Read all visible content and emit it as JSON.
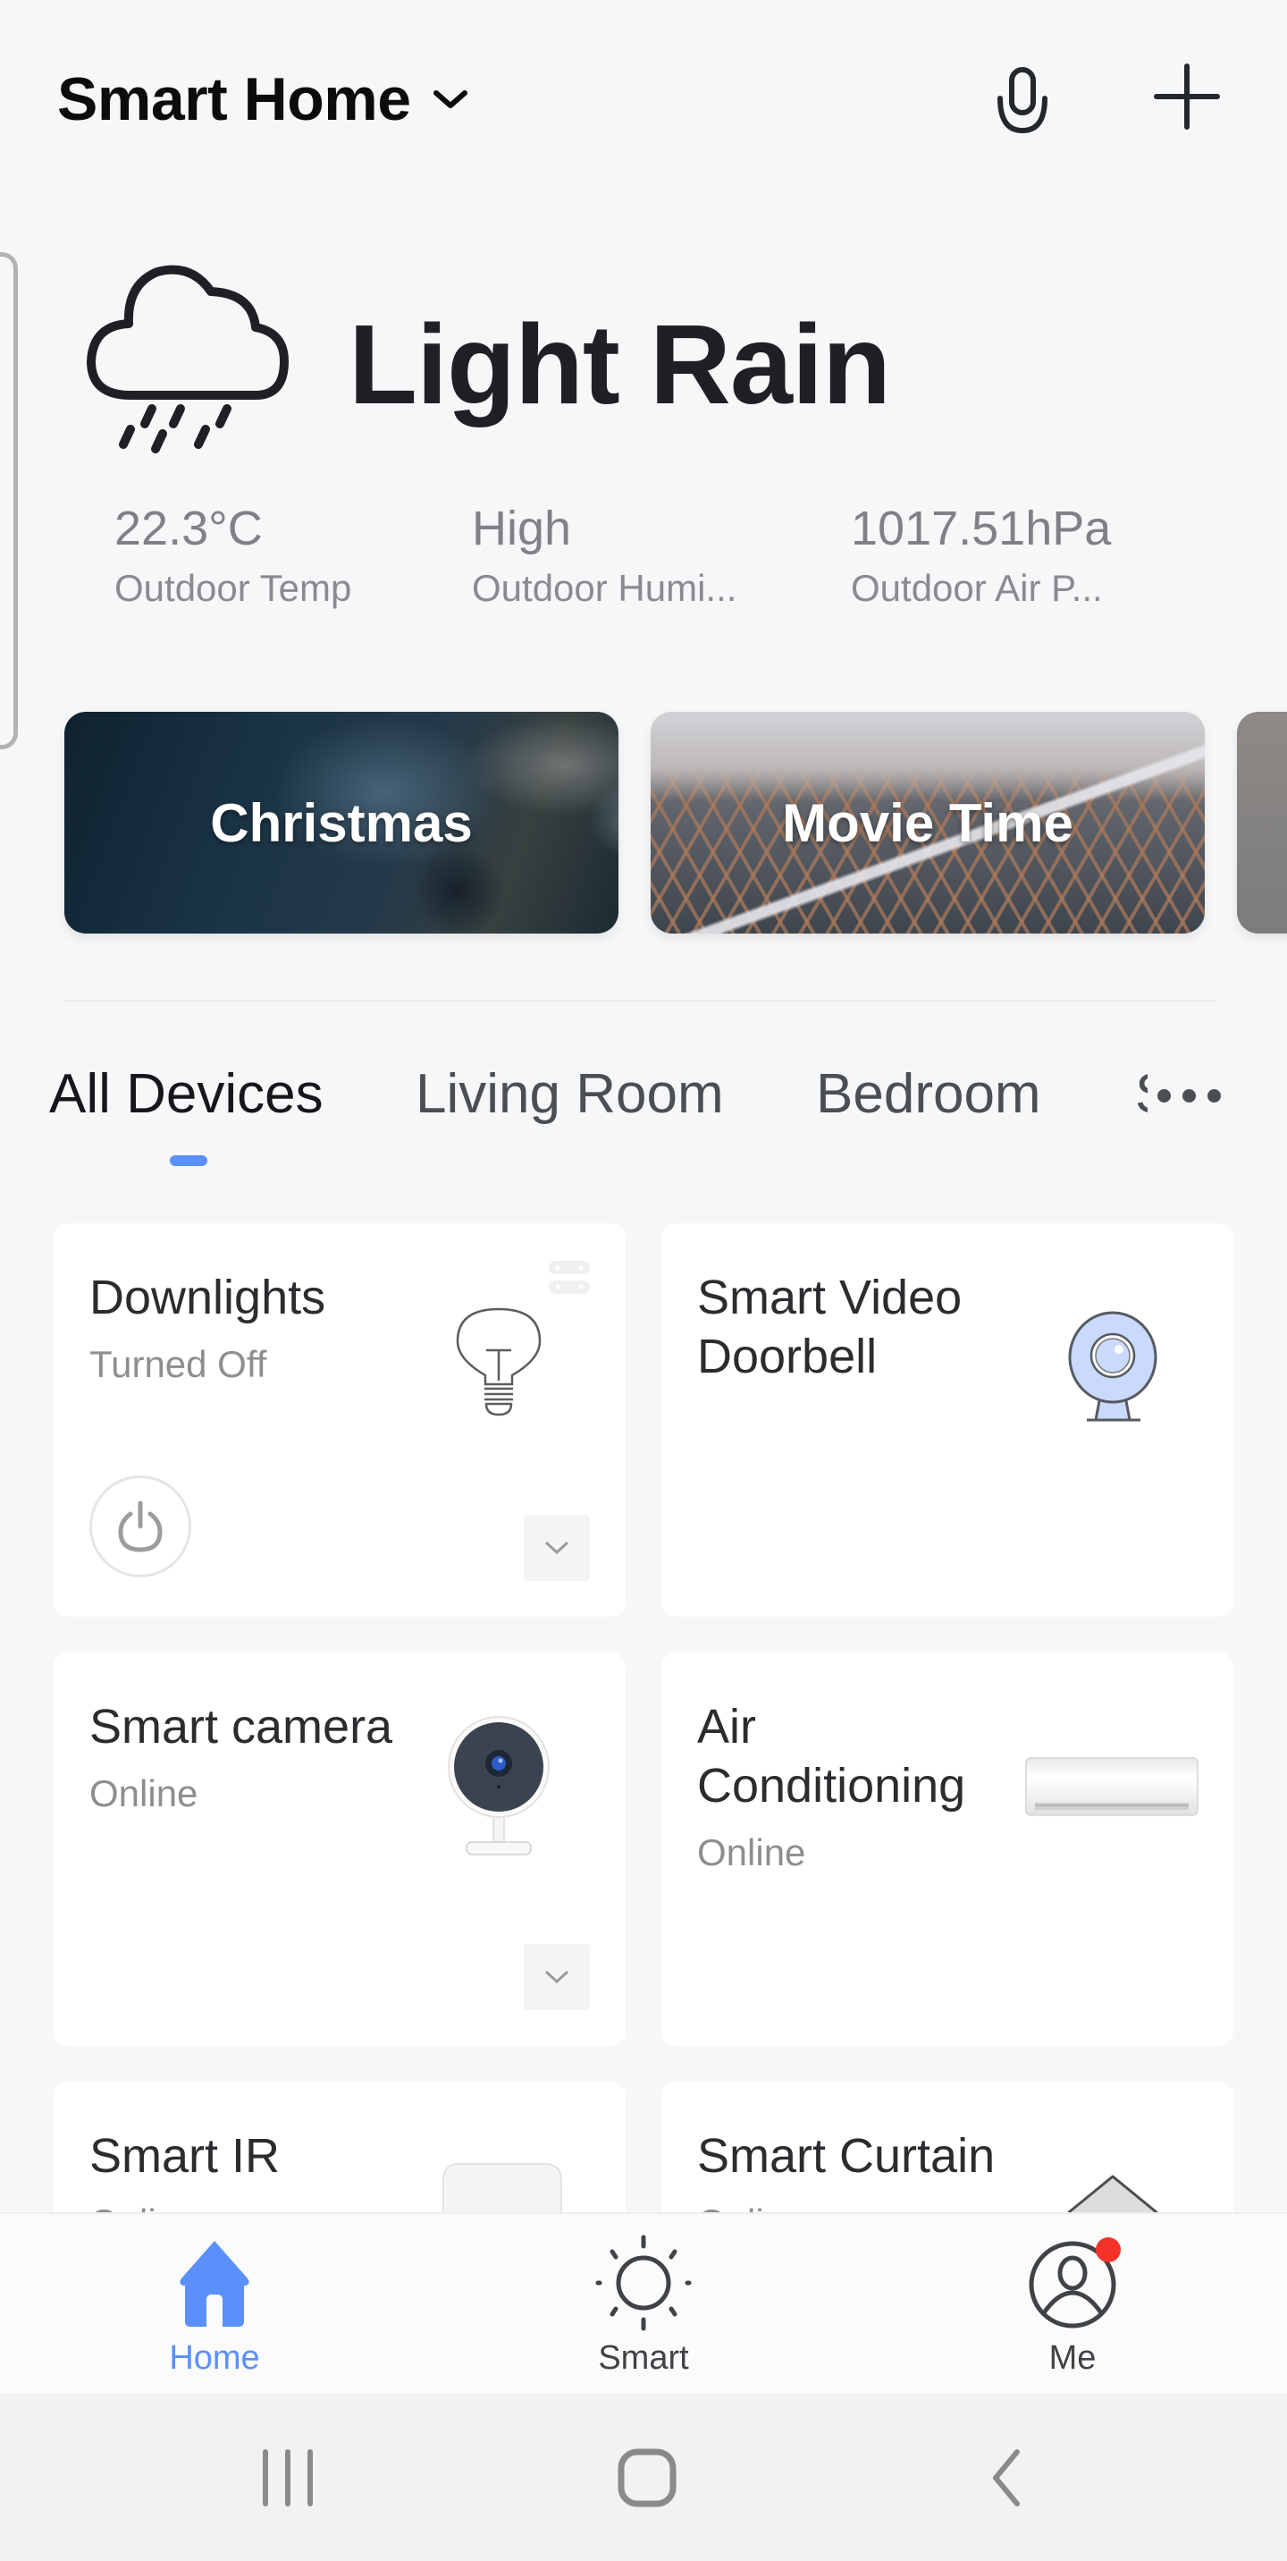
{
  "header": {
    "home_name": "Smart Home",
    "icons": {
      "dropdown": "chevron-down-icon",
      "voice": "microphone-icon",
      "add": "plus-icon"
    }
  },
  "weather": {
    "condition": "Light Rain",
    "icon": "cloud-rain-icon",
    "stats": [
      {
        "value": "22.3°C",
        "label": "Outdoor Temp"
      },
      {
        "value": "High",
        "label": "Outdoor Humi..."
      },
      {
        "value": "1017.51hPa",
        "label": "Outdoor Air P..."
      }
    ]
  },
  "scenes": [
    {
      "label": "Christmas"
    },
    {
      "label": "Movie Time"
    },
    {
      "label": ""
    }
  ],
  "rooms": {
    "tabs": [
      "All Devices",
      "Living Room",
      "Bedroom",
      "S"
    ],
    "active_index": 0,
    "more_icon": "more-horizontal-icon"
  },
  "devices": [
    {
      "name": "Downlights",
      "status": "Turned Off",
      "icon": "light-bulb-icon",
      "has_power": true,
      "has_expand": true
    },
    {
      "name": "Smart Video Doorbell",
      "status": "",
      "icon": "webcam-icon",
      "has_power": false,
      "has_expand": false
    },
    {
      "name": "Smart camera",
      "status": "Online",
      "icon": "security-camera-icon",
      "has_power": false,
      "has_expand": true
    },
    {
      "name": "Air Conditioning",
      "status": "Online",
      "icon": "air-conditioner-icon",
      "has_power": false,
      "has_expand": false
    },
    {
      "name": "Smart IR",
      "status": "Online",
      "icon": "ir-remote-icon",
      "has_power": false,
      "has_expand": false
    },
    {
      "name": "Smart Curtain",
      "status": "Online",
      "icon": "curtain-icon",
      "has_power": false,
      "has_expand": false
    }
  ],
  "bottom_nav": {
    "items": [
      {
        "label": "Home",
        "icon": "home-icon",
        "active": true
      },
      {
        "label": "Smart",
        "icon": "sun-icon",
        "active": false
      },
      {
        "label": "Me",
        "icon": "user-icon",
        "active": false,
        "badge": true
      }
    ]
  },
  "system_nav": {
    "recents": "recent-apps-icon",
    "home": "home-button-icon",
    "back": "back-icon"
  },
  "colors": {
    "accent": "#5b8ff9",
    "badge": "#f5322a",
    "background": "#f6f7f8"
  }
}
